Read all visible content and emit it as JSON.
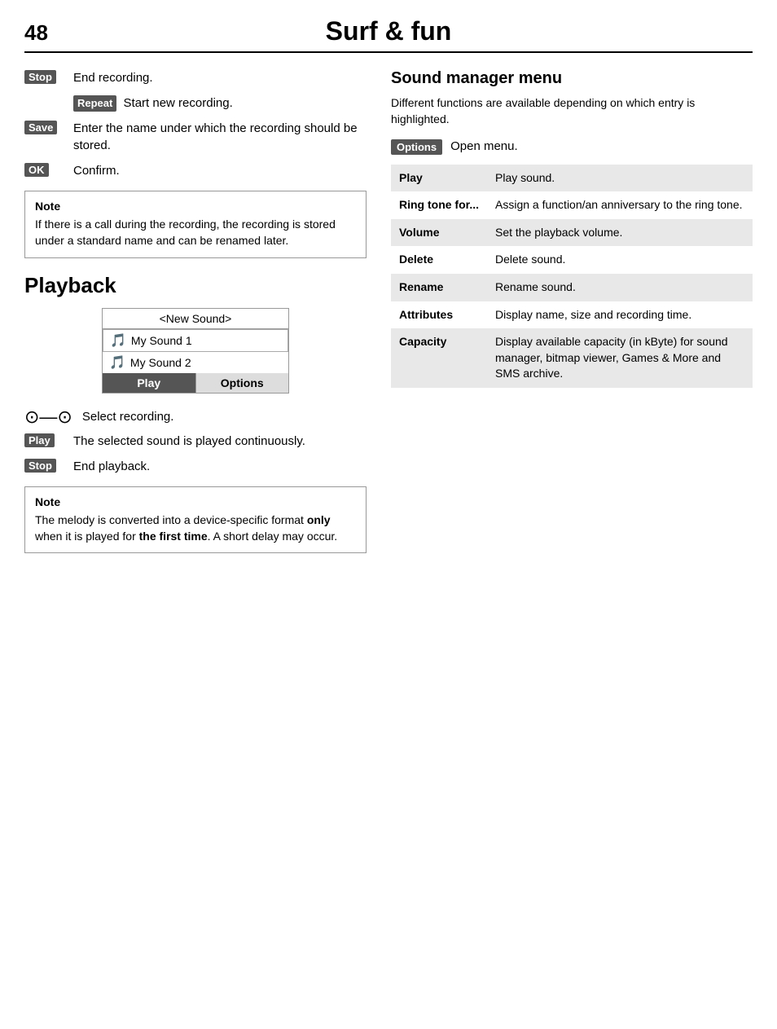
{
  "header": {
    "page_number": "48",
    "title": "Surf & fun"
  },
  "left_column": {
    "stop_badge": "Stop",
    "stop_text": "End recording.",
    "repeat_badge": "Repeat",
    "repeat_text": "Start new recording.",
    "save_badge": "Save",
    "save_text": "Enter the name under which the recording should be stored.",
    "ok_badge": "OK",
    "ok_text": "Confirm.",
    "note1_title": "Note",
    "note1_body": "If there is a call during the recording, the recording is stored under a standard name and can be renamed later.",
    "playback_heading": "Playback",
    "playback_new_sound": "<New Sound>",
    "playback_item1": "My Sound 1",
    "playback_item2": "My Sound 2",
    "playback_play_btn": "Play",
    "playback_options_btn": "Options",
    "nav_text": "Select recording.",
    "play_badge": "Play",
    "play_text": "The selected sound is played continuously.",
    "stop2_badge": "Stop",
    "stop2_text": "End playback.",
    "note2_title": "Note",
    "note2_body_part1": "The melody is converted into a device-specific format ",
    "note2_bold1": "only",
    "note2_body_part2": " when it is played for ",
    "note2_bold2": "the first time",
    "note2_body_part3": ". A short delay may occur."
  },
  "right_column": {
    "sound_manager_title": "Sound manager menu",
    "sound_manager_desc": "Different functions are available depending on which entry is highlighted.",
    "options_badge": "Options",
    "options_text": "Open menu.",
    "menu_rows": [
      {
        "label": "Play",
        "desc": "Play sound."
      },
      {
        "label": "Ring tone for...",
        "desc": "Assign a function/an anniversary to the ring tone."
      },
      {
        "label": "Volume",
        "desc": "Set the playback volume."
      },
      {
        "label": "Delete",
        "desc": "Delete sound."
      },
      {
        "label": "Rename",
        "desc": "Rename sound."
      },
      {
        "label": "Attributes",
        "desc": "Display name, size and recording time."
      },
      {
        "label": "Capacity",
        "desc": "Display available capacity (in kByte) for sound manager, bitmap viewer, Games & More and SMS archive."
      }
    ]
  }
}
